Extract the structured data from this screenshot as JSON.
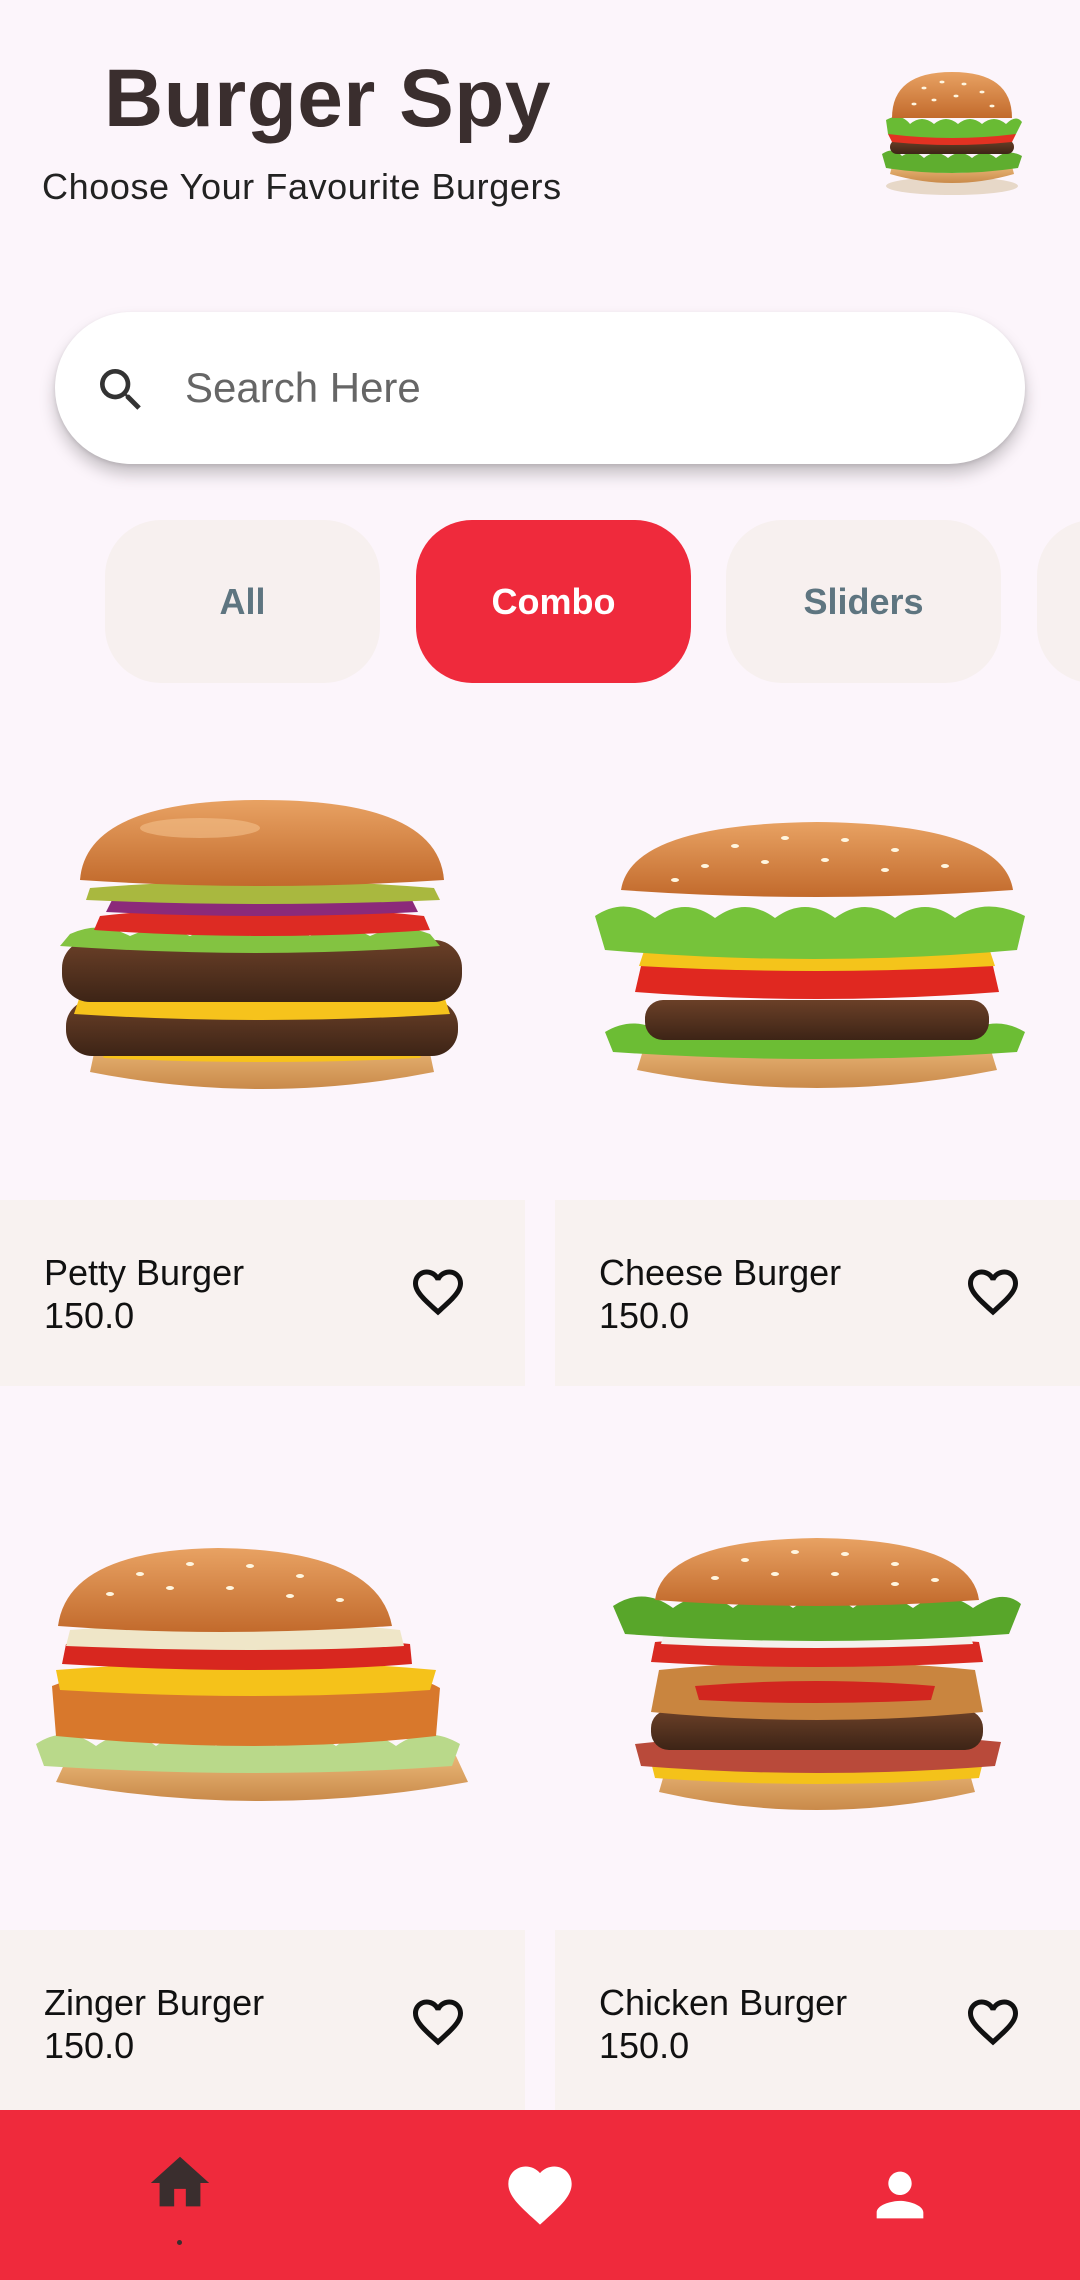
{
  "header": {
    "title": "Burger Spy",
    "subtitle": "Choose Your Favourite Burgers"
  },
  "search": {
    "placeholder": "Search Here"
  },
  "categories": [
    {
      "label": "All",
      "active": false
    },
    {
      "label": "Combo",
      "active": true
    },
    {
      "label": "Sliders",
      "active": false
    }
  ],
  "products": [
    {
      "name": "Petty Burger",
      "price": "150.0",
      "image": "double-patty-burger"
    },
    {
      "name": "Cheese Burger",
      "price": "150.0",
      "image": "sesame-cheese-burger"
    },
    {
      "name": "Zinger Burger",
      "price": "150.0",
      "image": "crispy-chicken-burger"
    },
    {
      "name": "Chicken Burger",
      "price": "150.0",
      "image": "stacked-chicken-bacon-burger"
    }
  ],
  "bottom_nav": {
    "items": [
      {
        "icon": "home-icon",
        "active": true
      },
      {
        "icon": "heart-icon",
        "active": false
      },
      {
        "icon": "person-icon",
        "active": false
      }
    ]
  },
  "colors": {
    "accent": "#ef2a3c",
    "background": "#fcf5fb",
    "tab_inactive_bg": "#f7f0ef",
    "tab_inactive_text": "#5e7580",
    "card_bg": "#f8f2f0",
    "title_text": "#3a2e2e"
  }
}
